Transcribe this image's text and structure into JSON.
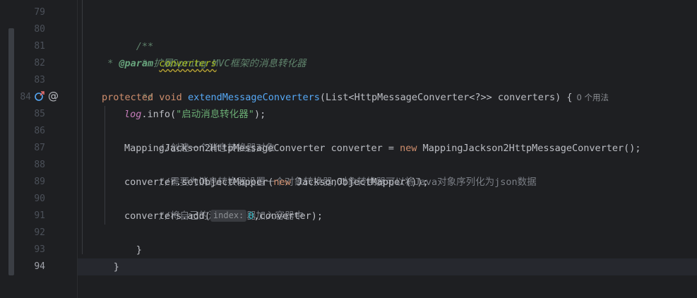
{
  "gutter": {
    "line_numbers": [
      "79",
      "80",
      "81",
      "82",
      "83",
      "84",
      "85",
      "86",
      "87",
      "88",
      "89",
      "90",
      "91",
      "92",
      "93",
      "94"
    ],
    "icons": {
      "override": "override-icon",
      "annotation": "at-annotation-icon"
    }
  },
  "code": {
    "l80": "/**",
    "l81": " * 扩展Spring MVC框架的消息转化器",
    "l82_star": " * ",
    "l82_tag": "@param",
    "l82_param": "converters",
    "l83": " */",
    "l84_kw1": "protected",
    "l84_kw2": "void",
    "l84_fn": "extendMessageConverters",
    "l84_rest": "(List<HttpMessageConverter<?>> converters) {",
    "l84_usage": "0 个用法",
    "l85_field": "log",
    "l85_call": ".info(",
    "l85_str": "\"启动消息转化器\"",
    "l85_end": ");",
    "l86": "//创建一个消息转换器对象",
    "l87_a": "MappingJackson2HttpMessageConverter converter = ",
    "l87_kw": "new",
    "l87_b": " MappingJackson2HttpMessageConverter();",
    "l88": "//需要为消息转换器设置一个对象转换器,对象转换器可以将Java对象序列化为json数据",
    "l89_a": "converter.setObjectMapper(",
    "l89_kw": "new",
    "l89_b": " JacksonObjectMapper());",
    "l90": "//将自己的消息转化器加入容器中",
    "l91_a": "converters.add(",
    "l91_hint": "index:",
    "l91_num": "0",
    "l91_b": ",converter);",
    "l92": "}",
    "l93": "}"
  },
  "colors": {
    "background": "#1e1f22",
    "keyword": "#cf8e6d",
    "function": "#56a8f5",
    "string": "#6aab73",
    "comment": "#7a7e85"
  }
}
